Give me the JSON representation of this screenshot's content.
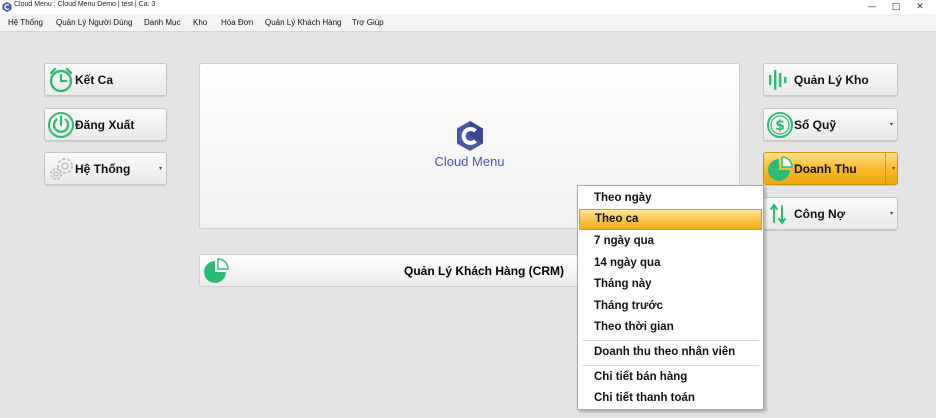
{
  "window": {
    "title": "Cloud Menu : Cloud Menu Demo | test | Ca: 3",
    "controls": [
      "—",
      "□",
      "✕"
    ]
  },
  "menubar": [
    "Hệ Thống",
    "Quản Lý Người Dùng",
    "Danh Mục",
    "Kho",
    "Hóa Đơn",
    "Quản Lý Khách Hàng",
    "Trợ Giúp"
  ],
  "left_buttons": {
    "ket_ca": "Kết Ca",
    "dang_xuat": "Đăng Xuất",
    "he_thong": "Hệ Thống"
  },
  "center": {
    "logo_text": "Cloud Menu",
    "crm_label": "Quản Lý Khách Hàng (CRM)"
  },
  "right_buttons": {
    "quan_ly_kho": "Quản Lý Kho",
    "so_quy": "Sổ Quỹ",
    "doanh_thu": "Doanh Thu",
    "cong_no": "Công Nợ"
  },
  "dropdown": {
    "items": [
      "Theo ngày",
      "Theo ca",
      "7 ngày qua",
      "14 ngày qua",
      "Tháng này",
      "Tháng trước",
      "Theo thời gian",
      "Doanh thu theo nhân viên",
      "Chi tiết bán hàng",
      "Chi tiết thanh toán"
    ],
    "selected": "Theo ca"
  },
  "colors": {
    "accent_orange": "#f6b726",
    "icon_green": "#2dbb73",
    "logo_blue": "#4a57a6"
  }
}
